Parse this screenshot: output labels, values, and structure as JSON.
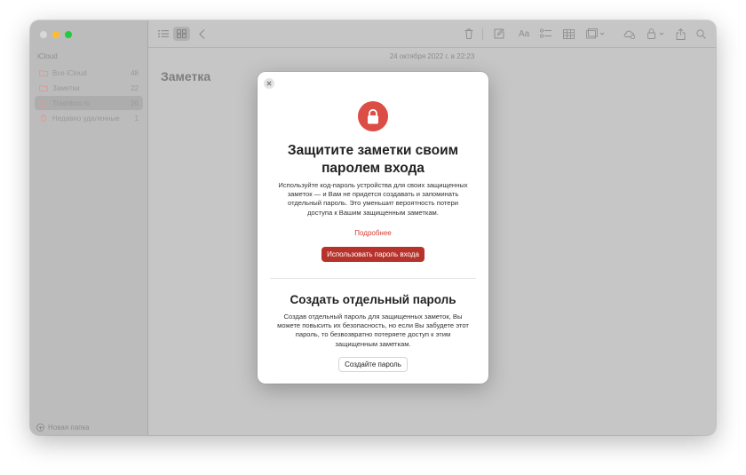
{
  "sidebar": {
    "section_title": "iCloud",
    "items": [
      {
        "label": "Все iCloud",
        "count": "48"
      },
      {
        "label": "Заметки",
        "count": "22"
      },
      {
        "label": "Trashbox.ru",
        "count": "26"
      },
      {
        "label": "Недавно удаленные",
        "count": "1"
      }
    ],
    "new_folder_label": "Новая папка"
  },
  "toolbar": {
    "icons": [
      "list-view-icon",
      "gallery-view-icon",
      "back-icon",
      "trash-icon",
      "compose-icon",
      "format-icon",
      "checklist-icon",
      "table-icon",
      "media-icon",
      "collaborate-icon",
      "lock-icon",
      "share-icon",
      "search-icon"
    ],
    "format_label": "Aa"
  },
  "note": {
    "date": "24 октября 2022 г. в 22:23",
    "title": "Заметка"
  },
  "modal": {
    "title": "Защитите заметки своим паролем входа",
    "description": "Используйте код-пароль устройства для своих защищенных заметок — и Вам не придется создавать и запоминать отдельный пароль. Это уменьшит вероятность потери доступа к Вашим защищенным заметкам.",
    "link": "Подробнее",
    "primary_button": "Использовать пароль входа",
    "title2": "Создать отдельный пароль",
    "description2": "Создав отдельный пароль для защищенных заметок, Вы можете повысить их безопасность, но если Вы забудете этот пароль, то безвозвратно потеряете доступ к этим защищенным заметкам.",
    "secondary_button": "Создайте пароль"
  },
  "colors": {
    "accent": "#dc4d45",
    "primary_button": "#b7322b",
    "link": "#d23c32"
  }
}
